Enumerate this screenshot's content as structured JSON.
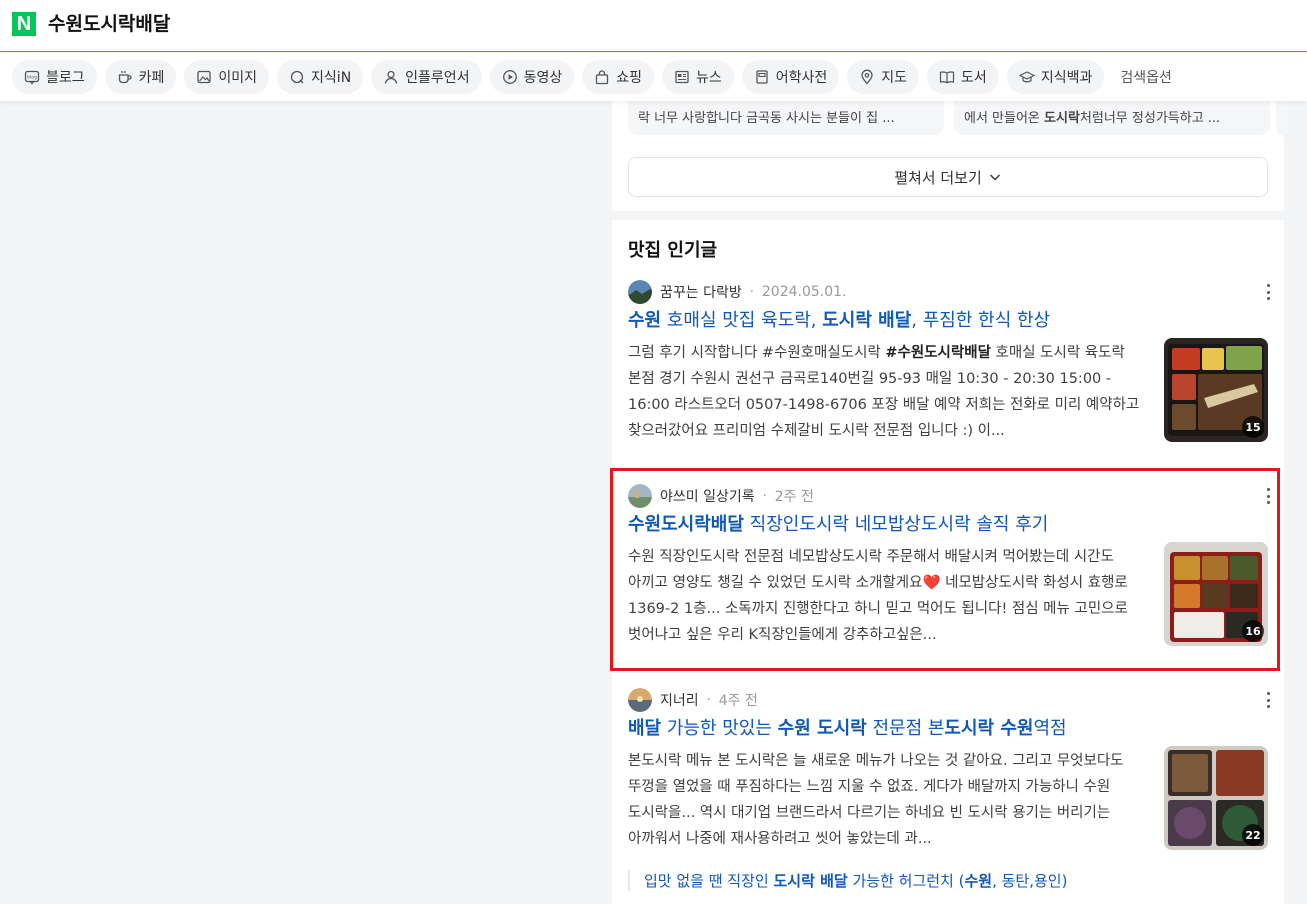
{
  "header": {
    "query": "수원도시락배달"
  },
  "tabs": [
    {
      "label": "블로그",
      "icon": "blog-icon"
    },
    {
      "label": "카페",
      "icon": "cafe-icon"
    },
    {
      "label": "이미지",
      "icon": "image-icon"
    },
    {
      "label": "지식iN",
      "icon": "kin-icon"
    },
    {
      "label": "인플루언서",
      "icon": "person-icon"
    },
    {
      "label": "동영상",
      "icon": "play-icon"
    },
    {
      "label": "쇼핑",
      "icon": "shopping-bag-icon"
    },
    {
      "label": "뉴스",
      "icon": "news-icon"
    },
    {
      "label": "어학사전",
      "icon": "dictionary-icon"
    },
    {
      "label": "지도",
      "icon": "map-pin-icon"
    },
    {
      "label": "도서",
      "icon": "book-icon"
    },
    {
      "label": "지식백과",
      "icon": "graduation-cap-icon"
    }
  ],
  "search_options": "검색옵션",
  "top_snippets": [
    {
      "line": "락 너무 사랑합니다 금곡동 사시는 분들이 집 ..."
    },
    {
      "line_pre": "에서 만들어온 ",
      "line_bold": "도시락",
      "line_post": "처럼너무 정성가득하고 ..."
    }
  ],
  "expand_button": "펼쳐서 더보기",
  "section": {
    "title": "맛집 인기글",
    "posts": [
      {
        "author": "꿈꾸는 다락방",
        "date": "2024.05.01.",
        "title_parts": [
          {
            "text": "수원",
            "bold": true
          },
          {
            "text": " 호매실 맛집 육도락, ",
            "bold": false
          },
          {
            "text": "도시락 배달",
            "bold": true
          },
          {
            "text": ", 푸짐한 한식 한상",
            "bold": false
          }
        ],
        "body_parts": [
          {
            "text": "그럼 후기 시작합니다 #수원호매실도시락 ",
            "bold": false
          },
          {
            "text": "#수원도시락배달",
            "bold": true
          },
          {
            "text": " 호매실 도시락 육도락 본점 경기 수원시 권선구 금곡로140번길 95-93 매일 10:30 - 20:30 15:00 - 16:00 라스트오더 0507-1498-6706 포장 배달 예약 저희는 전화로 미리 예약하고 찾으러갔어요 프리미엄 수제갈비 도시락 전문점 입니다 :) 이...",
            "bold": false
          }
        ],
        "image_count": "15"
      },
      {
        "author": "야쓰미 일상기록",
        "date": "2주 전",
        "title_parts": [
          {
            "text": "수원도시락배달",
            "bold": true
          },
          {
            "text": " 직장인도시락 네모밥상도시락 솔직 후기",
            "bold": false
          }
        ],
        "body_parts": [
          {
            "text": "수원 직장인도시락 전문점 네모밥상도시락 주문해서 배달시켜 먹어봤는데 시간도 아끼고 영양도 챙길 수 있었던 도시락 소개할게요",
            "bold": false
          },
          {
            "text": "❤️",
            "bold": false
          },
          {
            "text": " 네모밥상도시락 화성시 효행로 1369-2 1층... 소독까지 진행한다고 하니 믿고 먹어도 됩니다! 점심 메뉴 고민으로 벗어나고 싶은 우리 K직장인들에게 강추하고싶은...",
            "bold": false
          }
        ],
        "image_count": "16"
      },
      {
        "author": "지너리",
        "date": "4주 전",
        "title_parts": [
          {
            "text": "배달",
            "bold": true
          },
          {
            "text": " 가능한 맛있는 ",
            "bold": false
          },
          {
            "text": "수원 도시락",
            "bold": true
          },
          {
            "text": " 전문점 본",
            "bold": false
          },
          {
            "text": "도시락 수원",
            "bold": true
          },
          {
            "text": "역점",
            "bold": false
          }
        ],
        "body_parts": [
          {
            "text": "본도시락 메뉴 본 도시락은 늘 새로운 메뉴가 나오는 것 같아요. 그리고 무엇보다도 뚜껑을 열었을 때 푸짐하다는 느낌 지울 수 없죠. 게다가 배달까지 가능하니 수원 도시락을... 역시 대기업 브랜드라서 다르기는 하네요 빈 도시락 용기는 버리기는 아까워서 나중에 재사용하려고 씻어 놓았는데 과...",
            "bold": false
          }
        ],
        "image_count": "22"
      }
    ],
    "sub_link_parts": [
      {
        "text": "입맛 없을 땐 직장인 ",
        "bold": false
      },
      {
        "text": "도시락 배달",
        "bold": true
      },
      {
        "text": " 가능한 허그런치 (",
        "bold": false
      },
      {
        "text": "수원",
        "bold": true
      },
      {
        "text": ", 동탄,용인)",
        "bold": false
      }
    ]
  },
  "colors": {
    "brand": "#03c75a",
    "link": "#0f58b8",
    "highlight": "#e8141a"
  }
}
